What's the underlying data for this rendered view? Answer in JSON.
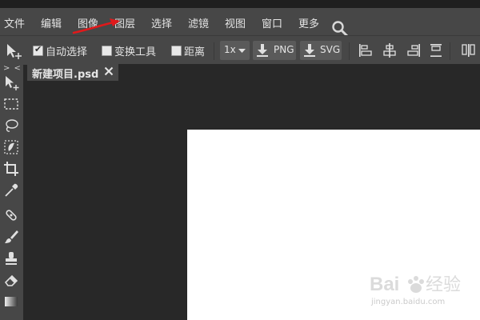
{
  "menubar": {
    "items": [
      "文件",
      "编辑",
      "图像",
      "图层",
      "选择",
      "滤镜",
      "视图",
      "窗口",
      "更多"
    ],
    "search_icon": "search-icon"
  },
  "annotation": {
    "arrow_color": "#e0191b"
  },
  "options_bar": {
    "move_tool_icon": "move-arrow-icon",
    "auto_select": {
      "label": "自动选择",
      "checked": true
    },
    "transform_controls": {
      "label": "变换工具",
      "checked": false
    },
    "distances": {
      "label": "距离",
      "checked": false
    },
    "zoom": {
      "value": "1x"
    },
    "export_png_label": "PNG",
    "export_svg_label": "SVG"
  },
  "tool_panel": {
    "collapse_label": "> <",
    "tools": [
      "move-tool-icon",
      "marquee-tool-icon",
      "lasso-tool-icon",
      "quick-select-tool-icon",
      "crop-tool-icon",
      "eyedropper-tool-icon",
      "healing-brush-tool-icon",
      "brush-tool-icon",
      "clone-stamp-tool-icon",
      "eraser-tool-icon",
      "gradient-tool-icon"
    ]
  },
  "document_tabs": [
    {
      "title": "新建项目.psd",
      "active": true
    }
  ],
  "canvas": {
    "background": "#ffffff"
  },
  "watermark": {
    "logo_text": "Baidu经验",
    "url": "jingyan.baidu.com"
  }
}
